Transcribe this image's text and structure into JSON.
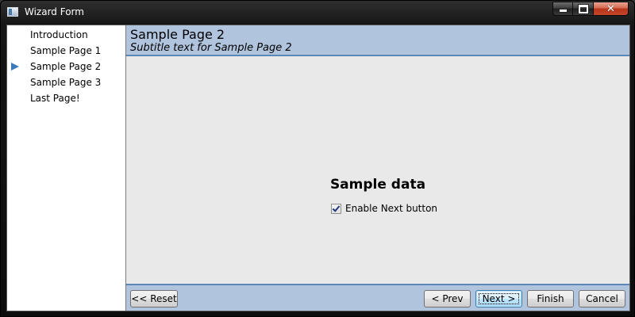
{
  "window": {
    "title": "Wizard Form",
    "icon": "app-window-icon",
    "caption_buttons": {
      "minimize": "minimize-icon",
      "maximize": "maximize-icon",
      "close": "✕"
    }
  },
  "sidebar": {
    "items": [
      {
        "label": "Introduction",
        "active": false
      },
      {
        "label": "Sample Page 1",
        "active": false
      },
      {
        "label": "Sample Page 2",
        "active": true
      },
      {
        "label": "Sample Page 3",
        "active": false
      },
      {
        "label": "Last Page!",
        "active": false
      }
    ]
  },
  "header": {
    "title": "Sample Page 2",
    "subtitle": "Subtitle text for Sample Page 2"
  },
  "content": {
    "heading": "Sample data",
    "checkbox_label": "Enable Next button",
    "checkbox_checked": true
  },
  "footer": {
    "reset_label": "<< Reset",
    "prev_label": "< Prev",
    "next_label": "Next >",
    "finish_label": "Finish",
    "cancel_label": "Cancel"
  },
  "colors": {
    "header_bg": "#b0c4de",
    "accent_border": "#5a87b6",
    "active_arrow": "#3d7ab8",
    "content_bg": "#e9e9e9"
  }
}
